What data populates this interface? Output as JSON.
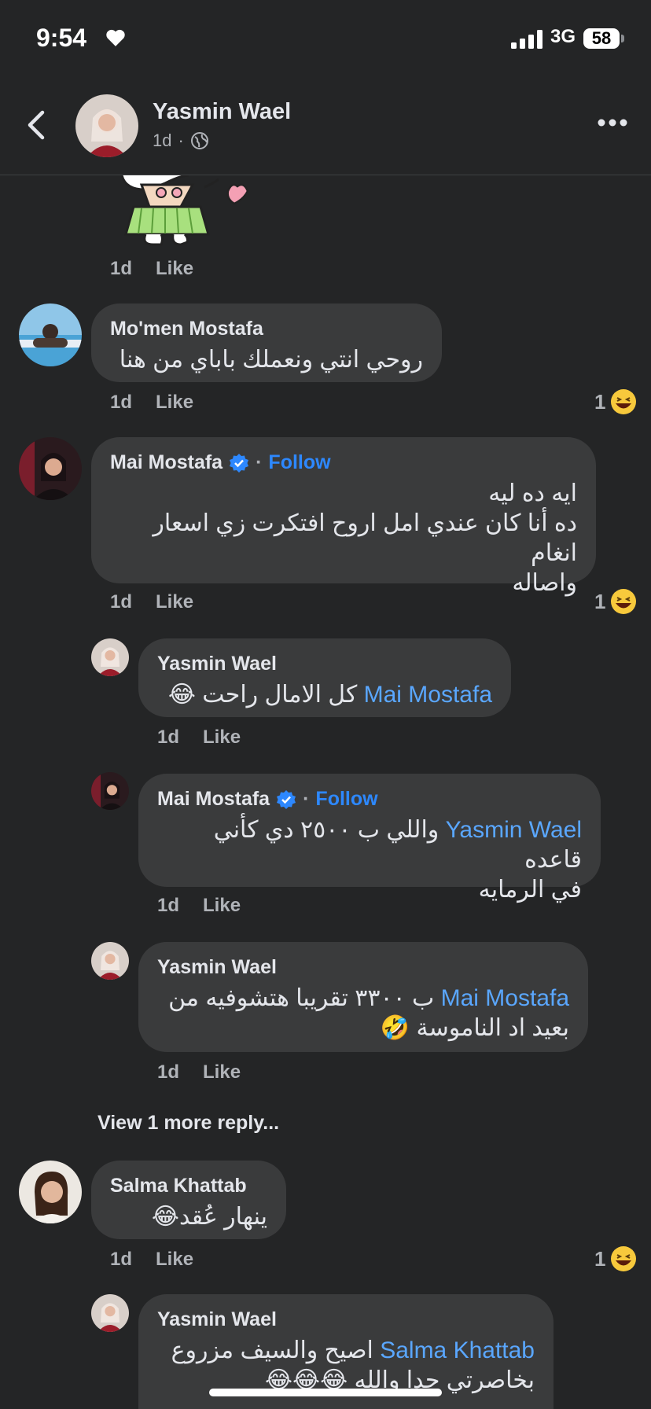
{
  "status_bar": {
    "time": "9:54",
    "network": "3G",
    "battery": "58"
  },
  "header": {
    "name": "Yasmin Wael",
    "time": "1d",
    "dot": "·"
  },
  "labels": {
    "like": "Like",
    "follow": "Follow",
    "dot": "·"
  },
  "comments": [
    {
      "id": "c1",
      "name": "Mo'men Mostafa",
      "text": "روحي انتي ونعملك  باباي من هنا",
      "time": "1d",
      "reactions": "1"
    },
    {
      "id": "c2",
      "name": "Mai Mostafa",
      "lines": [
        "ايه ده ليه",
        "ده أنا كان عندي امل اروح افتكرت زي اسعار انغام",
        "واصاله"
      ],
      "time": "1d",
      "reactions": "1"
    },
    {
      "id": "r1",
      "name": "Yasmin Wael",
      "mention": "Mai Mostafa",
      "text": "كل الامال راحت 😂",
      "time": "1d"
    },
    {
      "id": "r2",
      "name": "Mai Mostafa",
      "mention": "Yasmin Wael",
      "text1": "واللي ب ٢٥٠٠ دي كأني قاعده",
      "text2": "في الرمايه",
      "time": "1d"
    },
    {
      "id": "r3",
      "name": "Yasmin Wael",
      "mention": "Mai Mostafa",
      "text1": "ب ٣٣٠٠ تقريبا هتشوفيه من",
      "text2": "بعيد اد الناموسة 🤣",
      "time": "1d"
    },
    {
      "id": "c3",
      "name": "Salma Khattab",
      "text": "ينهار عُقد😂",
      "time": "1d",
      "reactions": "1"
    },
    {
      "id": "r4",
      "name": "Yasmin Wael",
      "mention": "Salma Khattab",
      "text1": "اصيح والسيف مزروع",
      "text2": "بخاصرتي حدا والله 😂😂😂"
    }
  ],
  "sticker": {
    "time": "1d"
  },
  "view_more": "View 1 more reply...",
  "colors": {
    "background": "#242526",
    "bubble": "#3a3b3c",
    "link": "#2d88ff",
    "mention": "#5aa7ff",
    "muted": "#b0b3b8"
  },
  "icons": [
    "heart-icon",
    "signal-icon",
    "back-icon",
    "globe-icon",
    "more-icon",
    "verified-icon",
    "laugh-reaction-icon"
  ]
}
